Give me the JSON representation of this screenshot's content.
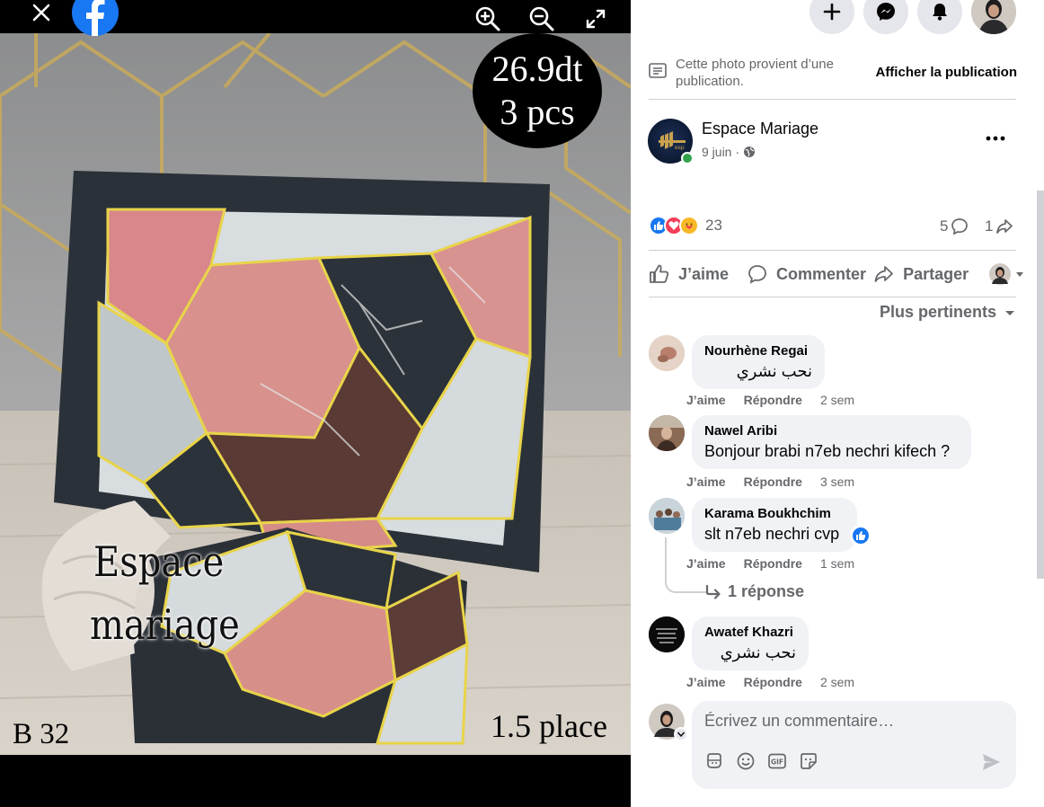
{
  "photo": {
    "price_line1": "26.9dt",
    "price_line2": "3 pcs",
    "ref_code": "B 32",
    "size_label": "1.5 place",
    "watermark_line1": "Espace",
    "watermark_line2": "mariage"
  },
  "viewer_controls": {
    "close_icon": "close-icon",
    "logo": "facebook-logo",
    "zoom_in_icon": "zoom-in-icon",
    "zoom_out_icon": "zoom-out-icon",
    "fullscreen_icon": "fullscreen-icon"
  },
  "topbar": {
    "icons": [
      "plus-icon",
      "messenger-icon",
      "bell-icon",
      "profile-avatar"
    ]
  },
  "notice": {
    "text": "Cette photo provient d’une publication.",
    "link": "Afficher la publication"
  },
  "post": {
    "author": "Espace Mariage",
    "date": "9 juin",
    "date_separator": "·",
    "reactions_count": "23",
    "comments_count": "5",
    "shares_count": "1"
  },
  "actions": {
    "like": "J’aime",
    "comment": "Commenter",
    "share": "Partager"
  },
  "sort_label": "Plus pertinents",
  "comments": [
    {
      "name": "Nourhène Regai",
      "text": "نحب نشري",
      "like": "J’aime",
      "reply": "Répondre",
      "time": "2 sem"
    },
    {
      "name": "Nawel Aribi",
      "text": "Bonjour brabi n7eb nechri kifech ?",
      "like": "J’aime",
      "reply": "Répondre",
      "time": "3 sem"
    },
    {
      "name": "Karama Boukhchim",
      "text": "slt n7eb nechri cvp",
      "like": "J’aime",
      "reply": "Répondre",
      "time": "1 sem",
      "replies": "1 réponse"
    },
    {
      "name": "Awatef Khazri",
      "text": "نحب نشري",
      "like": "J’aime",
      "reply": "Répondre",
      "time": "2 sem"
    }
  ],
  "composer": {
    "placeholder": "Écrivez un commentaire…"
  },
  "colors": {
    "facebook_blue": "#1877f2",
    "online_green": "#31a24c",
    "secondary_text": "#65676b",
    "bubble_bg": "#f0f2f5"
  }
}
